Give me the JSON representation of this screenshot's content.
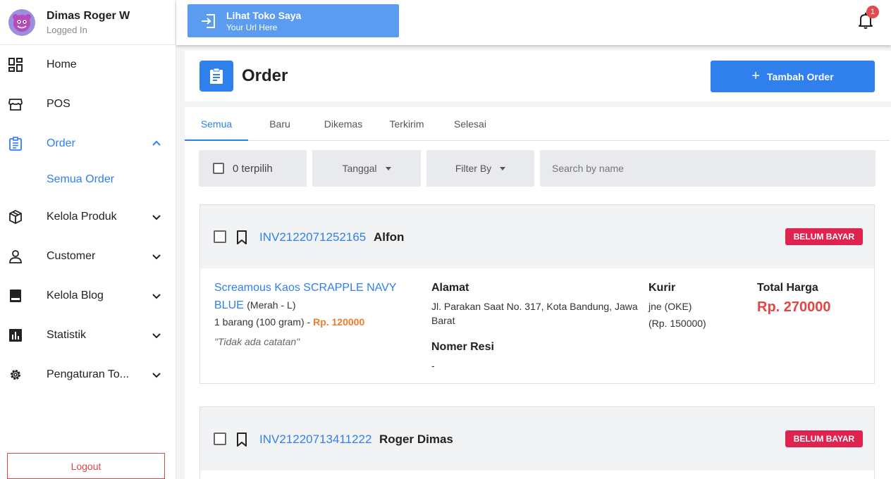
{
  "user": {
    "name": "Dimas Roger W",
    "status": "Logged In"
  },
  "sidebar": {
    "items": [
      {
        "label": "Home"
      },
      {
        "label": "POS"
      },
      {
        "label": "Order"
      },
      {
        "label": "Kelola Produk"
      },
      {
        "label": "Customer"
      },
      {
        "label": "Kelola Blog"
      },
      {
        "label": "Statistik"
      },
      {
        "label": "Pengaturan To..."
      }
    ],
    "sub_items": [
      {
        "label": "Semua Order"
      }
    ],
    "logout": "Logout"
  },
  "topbar": {
    "store_title": "Lihat Toko Saya",
    "store_sub": "Your Url Here",
    "notification_count": "1"
  },
  "header": {
    "title": "Order",
    "add_button": "Tambah Order"
  },
  "tabs": [
    "Semua",
    "Baru",
    "Dikemas",
    "Terkirim",
    "Selesai"
  ],
  "filters": {
    "selected": "0 terpilih",
    "date": "Tanggal",
    "filter_by": "Filter By",
    "search_placeholder": "Search by name"
  },
  "orders": [
    {
      "invoice": "INV2122071252165",
      "customer": "Alfon",
      "status": "BELUM BAYAR",
      "product_name": "Screamous Kaos SCRAPPLE NAVY BLUE",
      "variant": "(Merah - L)",
      "quantity": "1 barang (100 gram) - ",
      "price": "Rp. 120000",
      "note": "\"Tidak ada catatan\"",
      "address_label": "Alamat",
      "address": "Jl. Parakan Saat No. 317, Kota Bandung, Jawa Barat",
      "receipt_label": "Nomer Resi",
      "receipt": "-",
      "courier_label": "Kurir",
      "courier": "jne (OKE)",
      "courier_cost": "(Rp. 150000)",
      "total_label": "Total Harga",
      "total": "Rp. 270000"
    },
    {
      "invoice": "INV21220713411222",
      "customer": "Roger Dimas",
      "status": "BELUM BAYAR"
    }
  ],
  "colors": {
    "accent": "#2f80ed",
    "danger": "#e0234e",
    "price": "#f07c28"
  }
}
